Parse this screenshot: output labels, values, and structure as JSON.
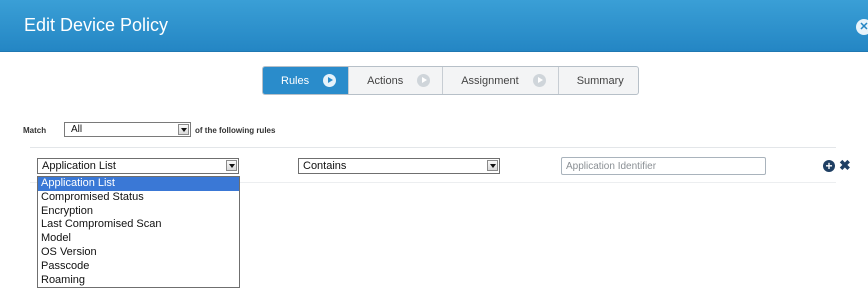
{
  "dialog": {
    "title": "Edit Device Policy",
    "close_icon": "close-icon"
  },
  "wizard": {
    "steps": [
      {
        "label": "Rules",
        "active": true
      },
      {
        "label": "Actions",
        "active": false
      },
      {
        "label": "Assignment",
        "active": false
      },
      {
        "label": "Summary",
        "active": false
      }
    ]
  },
  "match": {
    "prefix": "Match",
    "selected": "All",
    "suffix": "of the following rules"
  },
  "rule": {
    "field_selected": "Application List",
    "operator_selected": "Contains",
    "value_placeholder": "Application Identifier",
    "value": ""
  },
  "field_options": [
    "Application List",
    "Compromised Status",
    "Encryption",
    "Last Compromised Scan",
    "Model",
    "OS Version",
    "Passcode",
    "Roaming"
  ],
  "colors": {
    "titlebar": "#2486c4",
    "active_step": "#2a8ccb",
    "selection": "#3a78d6",
    "icon_dark": "#1f3f63"
  }
}
